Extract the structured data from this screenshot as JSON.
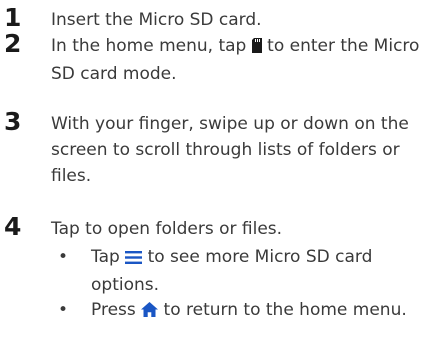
{
  "steps": [
    {
      "number": "1",
      "text": "Insert the Micro SD card."
    },
    {
      "number": "2",
      "text_before": "In the home menu, tap ",
      "icon": "sd-card-icon",
      "text_after": " to enter the Micro SD card mode."
    },
    {
      "number": "3",
      "text": "With your finger, swipe up or down on the screen to scroll through lists of folders or files."
    },
    {
      "number": "4",
      "text": "Tap to open folders or files."
    }
  ],
  "bullets": [
    {
      "marker": "•",
      "text_before": "Tap ",
      "icon": "menu-icon",
      "text_after": " to see more Micro SD card options."
    },
    {
      "marker": "•",
      "text_before": "Press ",
      "icon": "home-icon",
      "text_after": " to return to the home menu."
    }
  ],
  "colors": {
    "icon_accent": "#1a56c4",
    "text": "#3a3a3a"
  }
}
